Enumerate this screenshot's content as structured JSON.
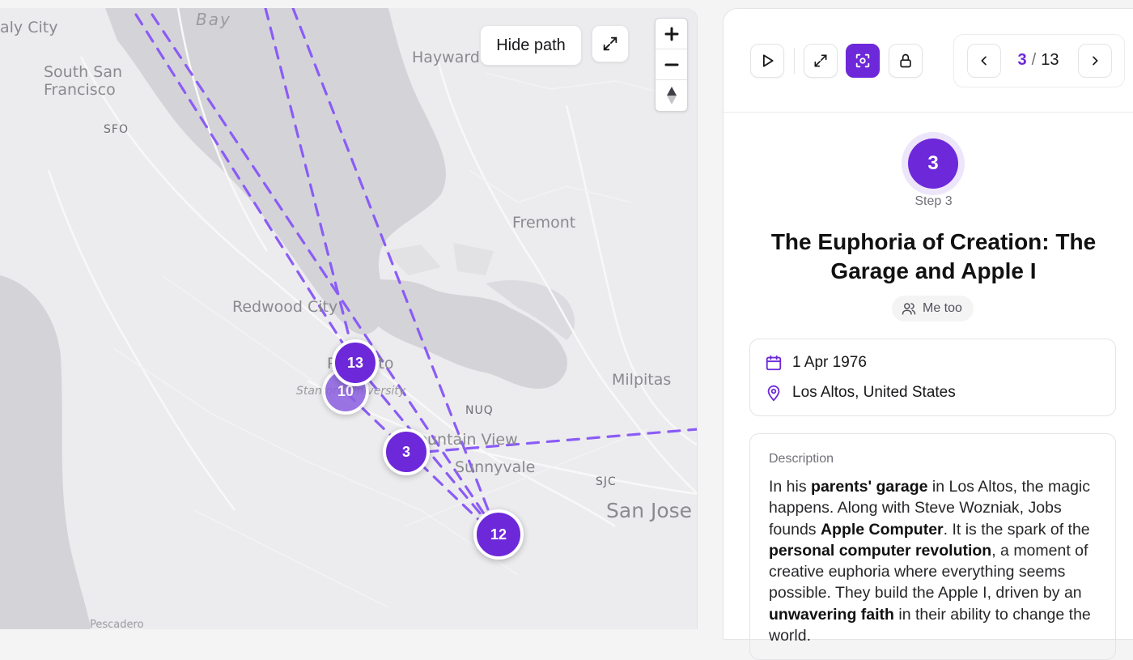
{
  "map": {
    "labels": {
      "daly_city": "aly City",
      "bay": "Bay",
      "south_sf": "South San\nFrancisco",
      "sfo": "SFO",
      "hayward": "Hayward",
      "fremont": "Fremont",
      "redwood_city": "Redwood City",
      "milpitas": "Milpitas",
      "stanford": "Stanford University",
      "palo_alto": "Palo Alto",
      "nuq": "NUQ",
      "mountain_view": "Mountain View",
      "sunnyvale": "Sunnyvale",
      "sjc": "SJC",
      "san_jose": "San Jose",
      "pescadero": "Pescadero"
    },
    "markers": [
      {
        "label": "13"
      },
      {
        "label": "10"
      },
      {
        "label": "3"
      },
      {
        "label": "12"
      }
    ],
    "hide_path_label": "Hide path",
    "path_color": "#8b5cf6"
  },
  "toolbar": {
    "play_icon": "play-icon",
    "fullscreen_icon": "expand-icon",
    "focus_icon": "focus-icon",
    "lock_icon": "lock-icon"
  },
  "pager": {
    "current": "3",
    "separator": "/",
    "total": "13"
  },
  "step": {
    "number": "3",
    "label": "Step 3",
    "title": "The Euphoria of Creation: The Garage and Apple I",
    "chip": "Me too"
  },
  "info": {
    "date": "1 Apr 1976",
    "location": "Los Altos, United States"
  },
  "description": {
    "heading": "Description",
    "parts": [
      {
        "t": "In his ",
        "b": false
      },
      {
        "t": "parents' garage",
        "b": true
      },
      {
        "t": " in Los Altos, the magic happens. Along with Steve Wozniak, Jobs founds ",
        "b": false
      },
      {
        "t": "Apple Computer",
        "b": true
      },
      {
        "t": ". It is the spark of the ",
        "b": false
      },
      {
        "t": "personal computer revolution",
        "b": true
      },
      {
        "t": ", a moment of creative euphoria where everything seems possible. They build the Apple I, driven by an ",
        "b": false
      },
      {
        "t": "unwavering faith",
        "b": true
      },
      {
        "t": " in their ability to change the world.",
        "b": false
      }
    ]
  },
  "colors": {
    "accent": "#6d28d9",
    "water": "#d4d4d8",
    "land": "#ececee"
  }
}
